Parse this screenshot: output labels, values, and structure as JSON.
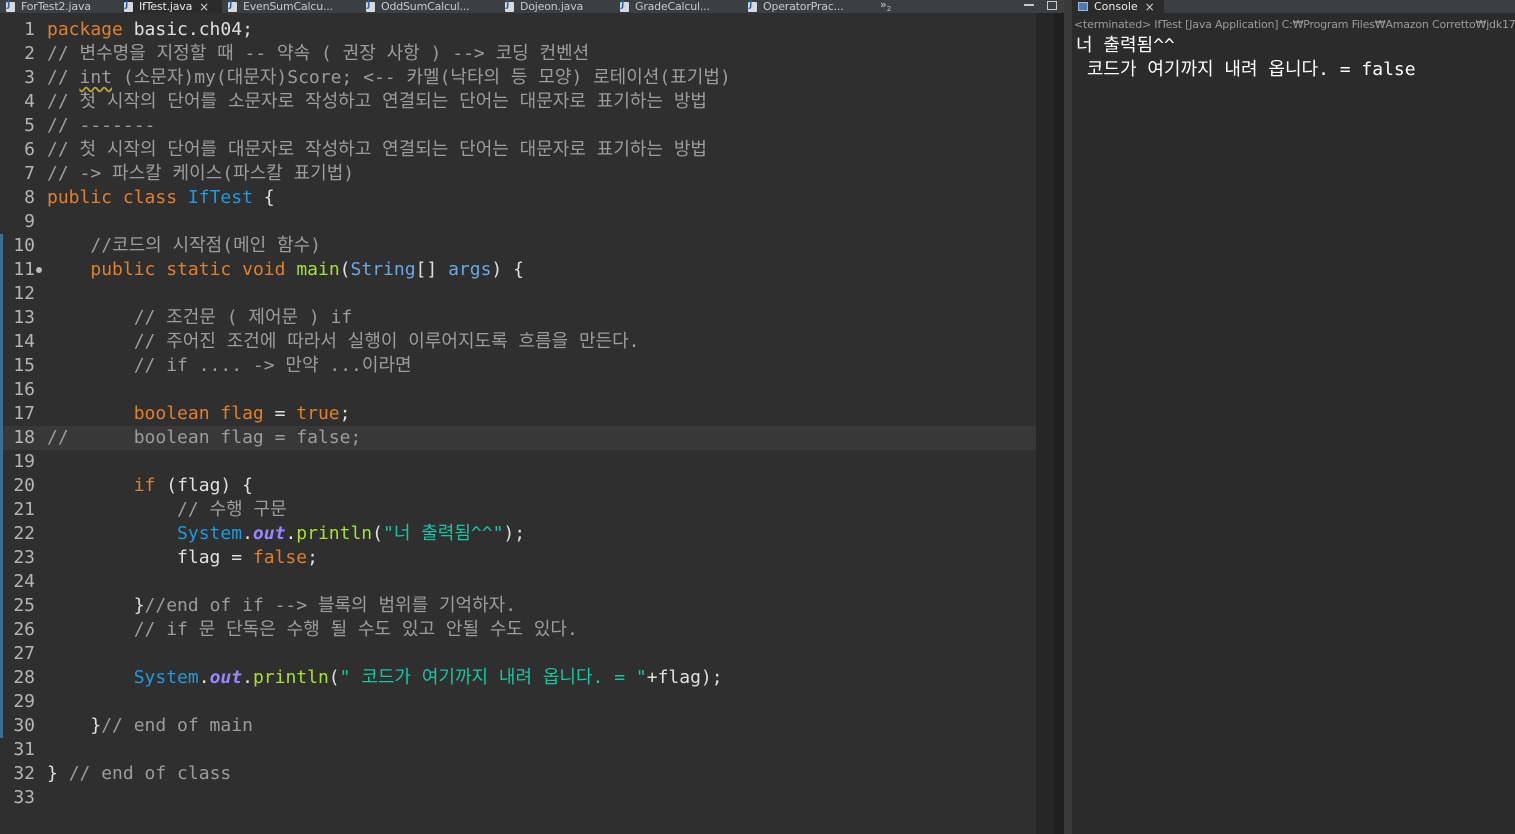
{
  "editor_tabs": [
    {
      "label": "ForTest2.java",
      "active": false
    },
    {
      "label": "IfTest.java",
      "active": true
    },
    {
      "label": "EvenSumCalcu...",
      "active": false
    },
    {
      "label": "OddSumCalcul...",
      "active": false
    },
    {
      "label": "Dojeon.java",
      "active": false
    },
    {
      "label": "GradeCalcul...",
      "active": false
    },
    {
      "label": "OperatorPrac...",
      "active": false
    }
  ],
  "overflow_label": "»",
  "overflow_count": "2",
  "editor": {
    "lines": [
      {
        "n": "1",
        "segs": [
          [
            "kw",
            "package"
          ],
          [
            "pln",
            " basic.ch04;"
          ]
        ]
      },
      {
        "n": "2",
        "segs": [
          [
            "cm",
            "// 변수명을 지정할 때 -- 약속 ( 권장 사항 ) --> 코딩 컨벤션"
          ]
        ]
      },
      {
        "n": "3",
        "segs": [
          [
            "cm",
            "// "
          ],
          [
            "cmu",
            "int"
          ],
          [
            "cm",
            " (소문자)my(대문자)Score; <-- 카멜(낙타의 등 모양) 로테이션(표기법)"
          ]
        ]
      },
      {
        "n": "4",
        "segs": [
          [
            "cm",
            "// 첫 시작의 단어를 소문자로 작성하고 연결되는 단어는 대문자로 표기하는 방법"
          ]
        ]
      },
      {
        "n": "5",
        "segs": [
          [
            "cm",
            "// -------"
          ]
        ]
      },
      {
        "n": "6",
        "segs": [
          [
            "cm",
            "// 첫 시작의 단어를 대문자로 작성하고 연결되는 단어는 대문자로 표기하는 방법"
          ]
        ]
      },
      {
        "n": "7",
        "segs": [
          [
            "cm",
            "// -> 파스칼 케이스(파스칼 표기법)"
          ]
        ]
      },
      {
        "n": "8",
        "segs": [
          [
            "kw",
            "public"
          ],
          [
            "pln",
            " "
          ],
          [
            "kw",
            "class"
          ],
          [
            "pln",
            " "
          ],
          [
            "cls",
            "IfTest"
          ],
          [
            "pln",
            " {"
          ]
        ]
      },
      {
        "n": "9",
        "segs": []
      },
      {
        "n": "10",
        "segs": [
          [
            "pln",
            "    "
          ],
          [
            "cm",
            "//코드의 시작점(메인 함수)"
          ]
        ]
      },
      {
        "n": "11",
        "segs": [
          [
            "pln",
            "    "
          ],
          [
            "kw",
            "public"
          ],
          [
            "pln",
            " "
          ],
          [
            "kw",
            "static"
          ],
          [
            "pln",
            " "
          ],
          [
            "kw",
            "void"
          ],
          [
            "pln",
            " "
          ],
          [
            "fn",
            "main"
          ],
          [
            "pln",
            "("
          ],
          [
            "typ",
            "String"
          ],
          [
            "pln",
            "[] "
          ],
          [
            "typ",
            "args"
          ],
          [
            "pln",
            ") {"
          ]
        ]
      },
      {
        "n": "12",
        "segs": []
      },
      {
        "n": "13",
        "segs": [
          [
            "pln",
            "        "
          ],
          [
            "cm",
            "// 조건문 ( 제어문 ) if"
          ]
        ]
      },
      {
        "n": "14",
        "segs": [
          [
            "pln",
            "        "
          ],
          [
            "cm",
            "// 주어진 조건에 따라서 실행이 이루어지도록 흐름을 만든다."
          ]
        ]
      },
      {
        "n": "15",
        "segs": [
          [
            "pln",
            "        "
          ],
          [
            "cm",
            "// if .... -> 만약 ...이라면"
          ]
        ]
      },
      {
        "n": "16",
        "segs": []
      },
      {
        "n": "17",
        "segs": [
          [
            "pln",
            "        "
          ],
          [
            "kw",
            "boolean"
          ],
          [
            "pln",
            " "
          ],
          [
            "kw",
            "flag"
          ],
          [
            "pln",
            " = "
          ],
          [
            "kw",
            "true"
          ],
          [
            "pln",
            ";"
          ]
        ]
      },
      {
        "n": "18",
        "segs": [
          [
            "cm",
            "//      boolean flag = false;"
          ]
        ]
      },
      {
        "n": "19",
        "segs": []
      },
      {
        "n": "20",
        "segs": [
          [
            "pln",
            "        "
          ],
          [
            "kw",
            "if"
          ],
          [
            "pln",
            " (flag) {"
          ]
        ]
      },
      {
        "n": "21",
        "segs": [
          [
            "pln",
            "            "
          ],
          [
            "cm",
            "// 수행 구문"
          ]
        ]
      },
      {
        "n": "22",
        "segs": [
          [
            "pln",
            "            "
          ],
          [
            "cls",
            "System"
          ],
          [
            "pln",
            "."
          ],
          [
            "fld",
            "out"
          ],
          [
            "pln",
            "."
          ],
          [
            "fn",
            "println"
          ],
          [
            "pln",
            "("
          ],
          [
            "str",
            "\"너 출력됨^^\""
          ],
          [
            "pln",
            ");"
          ]
        ]
      },
      {
        "n": "23",
        "segs": [
          [
            "pln",
            "            flag = "
          ],
          [
            "kw",
            "false"
          ],
          [
            "pln",
            ";"
          ]
        ]
      },
      {
        "n": "24",
        "segs": []
      },
      {
        "n": "25",
        "segs": [
          [
            "pln",
            "        }"
          ],
          [
            "cm",
            "//end of if --> 블록의 범위를 기억하자."
          ]
        ]
      },
      {
        "n": "26",
        "segs": [
          [
            "pln",
            "        "
          ],
          [
            "cm",
            "// if 문 단독은 수행 될 수도 있고 안될 수도 있다."
          ]
        ]
      },
      {
        "n": "27",
        "segs": []
      },
      {
        "n": "28",
        "segs": [
          [
            "pln",
            "        "
          ],
          [
            "cls",
            "System"
          ],
          [
            "pln",
            "."
          ],
          [
            "fld",
            "out"
          ],
          [
            "pln",
            "."
          ],
          [
            "fn",
            "println"
          ],
          [
            "pln",
            "("
          ],
          [
            "str",
            "\" 코드가 여기까지 내려 옵니다. = \""
          ],
          [
            "pln",
            "+flag);"
          ]
        ]
      },
      {
        "n": "29",
        "segs": []
      },
      {
        "n": "30",
        "segs": [
          [
            "pln",
            "    }"
          ],
          [
            "cm",
            "// end of main"
          ]
        ]
      },
      {
        "n": "31",
        "segs": []
      },
      {
        "n": "32",
        "segs": [
          [
            "pln",
            "} "
          ],
          [
            "cm",
            "// end of class"
          ]
        ]
      },
      {
        "n": "33",
        "segs": []
      }
    ],
    "highlighted_line": "18",
    "breakpoint_line": "11"
  },
  "console": {
    "tab_label": "Console",
    "status": "<terminated> IfTest [Java Application] C:₩Program Files₩Amazon Corretto₩jdk17",
    "output": [
      "너 출력됨^^",
      " 코드가 여기까지 내려 옵니다. = false"
    ]
  },
  "colors": {
    "keyword": "#e0802a",
    "comment": "#9c9c9c",
    "class_name": "#1e9ae0",
    "method": "#a6e22e",
    "string": "#17c6a3",
    "field": "#9b84ff",
    "background": "#2f2f2f"
  }
}
